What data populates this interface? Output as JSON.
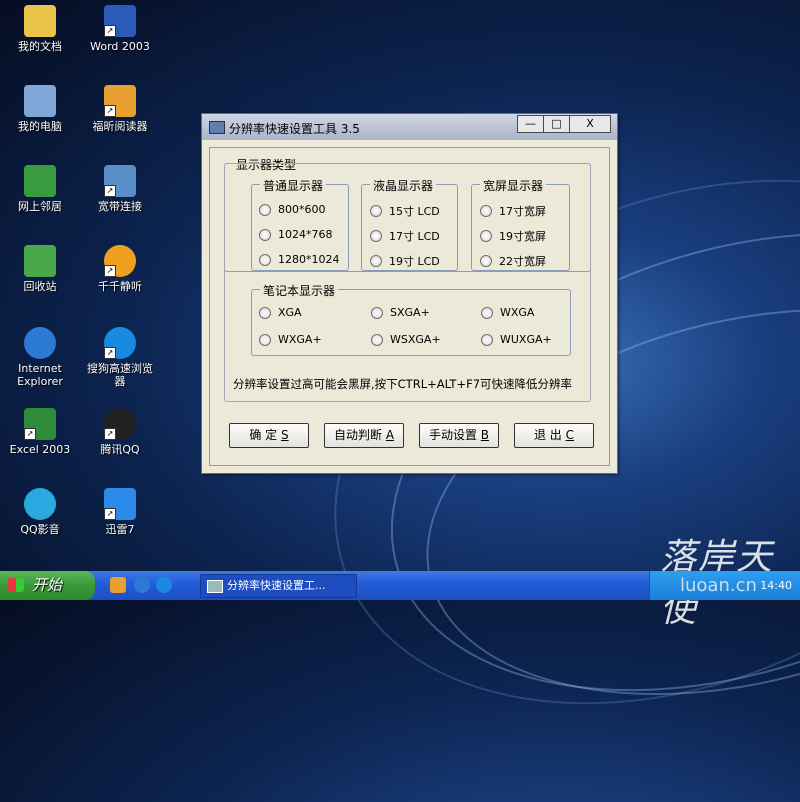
{
  "desktop": {
    "icons": [
      {
        "label": "我的文档",
        "icon": "my-documents-icon",
        "color": "#e8c44a"
      },
      {
        "label": "Word 2003",
        "icon": "word-icon",
        "color": "#2a5bb8"
      },
      {
        "label": "我的电脑",
        "icon": "my-computer-icon",
        "color": "#7fa8d8"
      },
      {
        "label": "福昕阅读器",
        "icon": "foxit-reader-icon",
        "color": "#e8a030"
      },
      {
        "label": "网上邻居",
        "icon": "network-icon",
        "color": "#3a9a40"
      },
      {
        "label": "宽带连接",
        "icon": "broadband-icon",
        "color": "#5a8ec8"
      },
      {
        "label": "回收站",
        "icon": "recycle-bin-icon",
        "color": "#4aa84a"
      },
      {
        "label": "千千静听",
        "icon": "ttplayer-icon",
        "color": "#f0a020"
      },
      {
        "label": "Internet Explorer",
        "icon": "ie-icon",
        "color": "#2c7ad6"
      },
      {
        "label": "搜狗高速浏览器",
        "icon": "sogou-browser-icon",
        "color": "#1a8ae0"
      },
      {
        "label": "Excel 2003",
        "icon": "excel-icon",
        "color": "#2f8a3a"
      },
      {
        "label": "腾讯QQ",
        "icon": "qq-icon",
        "color": "#222222"
      },
      {
        "label": "QQ影音",
        "icon": "qq-player-icon",
        "color": "#2aa8e0"
      },
      {
        "label": "迅雷7",
        "icon": "thunder-icon",
        "color": "#2c8ae8"
      }
    ]
  },
  "window": {
    "title": "分辨率快速设置工具 3.5",
    "controls": {
      "minimize": "—",
      "maximize": "□",
      "close": "X"
    },
    "display_group": {
      "label": "显示器类型",
      "normal": {
        "label": "普通显示器",
        "options": [
          "800*600",
          "1024*768",
          "1280*1024"
        ]
      },
      "lcd": {
        "label": "液晶显示器",
        "options": [
          "15寸 LCD",
          "17寸 LCD",
          "19寸 LCD"
        ]
      },
      "wide": {
        "label": "宽屏显示器",
        "options": [
          "17寸宽屏",
          "19寸宽屏",
          "22寸宽屏"
        ]
      }
    },
    "notebook_group": {
      "label": "笔记本显示器",
      "options": [
        "XGA",
        "SXGA+",
        "WXGA",
        "WXGA+",
        "WSXGA+",
        "WUXGA+"
      ]
    },
    "hint": "分辨率设置过高可能会黑屏,按下CTRL+ALT+F7可快速降低分辨率",
    "buttons": {
      "ok": {
        "label": "确 定",
        "key": "S"
      },
      "auto": {
        "label": "自动判断",
        "key": "A"
      },
      "manual": {
        "label": "手动设置",
        "key": "B"
      },
      "exit": {
        "label": "退 出",
        "key": "C"
      }
    }
  },
  "taskbar": {
    "start_label": "开始",
    "task_label": "分辨率快速设置工...",
    "clock": "14:40"
  },
  "watermark": {
    "text": "落岸天使",
    "url": "luoan.cn"
  }
}
